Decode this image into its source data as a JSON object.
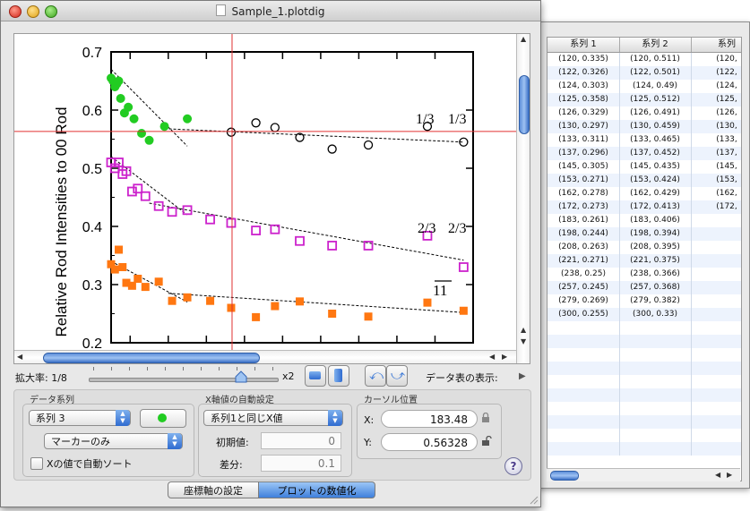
{
  "window": {
    "title": "Sample_1.plotdig"
  },
  "plot": {
    "ylabel": "Relative Rod Intensities to 00 Rod",
    "yticks": [
      "0.7",
      "0.6",
      "0.5",
      "0.4",
      "0.3",
      "0.2"
    ],
    "labels": {
      "a1": "1/3",
      "a2": "1/3",
      "b1": "2/3",
      "b2": "2/3",
      "c": "11"
    },
    "colors": {
      "crosshair": "#e03030",
      "green": "#22cc22",
      "magenta": "#cc22cc",
      "orange": "#ff7711"
    }
  },
  "chart_data": {
    "type": "scatter",
    "ylabel": "Relative Rod Intensities to 00 Rod",
    "ylim": [
      0.2,
      0.7
    ],
    "xlim": [
      120,
      310
    ],
    "grid": false,
    "crosshair": {
      "x": 183.48,
      "y": 0.56328
    },
    "series": [
      {
        "marker": "filled-circle",
        "color": "#22cc22",
        "x": [
          120,
          121,
          122,
          123,
          124,
          125,
          127,
          129,
          132,
          136,
          140,
          148,
          160
        ],
        "y": [
          0.655,
          0.65,
          0.64,
          0.645,
          0.65,
          0.62,
          0.595,
          0.605,
          0.585,
          0.56,
          0.548,
          0.572,
          0.585
        ]
      },
      {
        "marker": "open-circle",
        "color": "#000000",
        "x": [
          183,
          196,
          206,
          219,
          236,
          255,
          286,
          305
        ],
        "y": [
          0.562,
          0.578,
          0.57,
          0.553,
          0.533,
          0.54,
          0.572,
          0.545
        ]
      },
      {
        "marker": "open-square",
        "color": "#cc22cc",
        "x": [
          120,
          122,
          124,
          126,
          128,
          131,
          134,
          138,
          145,
          152,
          160,
          172,
          183,
          196,
          206,
          219,
          236,
          255,
          286,
          305
        ],
        "y": [
          0.51,
          0.5,
          0.51,
          0.49,
          0.495,
          0.46,
          0.465,
          0.452,
          0.435,
          0.425,
          0.428,
          0.412,
          0.406,
          0.393,
          0.395,
          0.375,
          0.367,
          0.367,
          0.384,
          0.33
        ]
      },
      {
        "marker": "filled-square",
        "color": "#ff7711",
        "x": [
          120,
          122,
          124,
          126,
          128,
          131,
          134,
          138,
          145,
          152,
          160,
          172,
          183,
          196,
          206,
          219,
          236,
          255,
          286,
          305
        ],
        "y": [
          0.335,
          0.326,
          0.36,
          0.33,
          0.303,
          0.298,
          0.31,
          0.296,
          0.305,
          0.272,
          0.278,
          0.272,
          0.26,
          0.244,
          0.263,
          0.271,
          0.25,
          0.245,
          0.269,
          0.255
        ]
      }
    ]
  },
  "zoom": {
    "label": "拡大率: 1/8",
    "max_label": "x2",
    "value": 0.8,
    "show_table_label": "データ表の表示:"
  },
  "series_group": {
    "title": "データ系列",
    "series_select": "系列 3",
    "color_swatch": "#22cc22",
    "style_select": "マーカーのみ",
    "autosort_label": "Xの値で自動ソート"
  },
  "xauto_group": {
    "title": "X軸値の自動設定",
    "mode_select": "系列1と同じX値",
    "initial_label": "初期値:",
    "initial_value": "0",
    "step_label": "差分:",
    "step_value": "0.1"
  },
  "cursor_group": {
    "title": "カーソル位置",
    "x_label": "X:",
    "x_value": "183.48",
    "y_label": "Y:",
    "y_value": "0.56328"
  },
  "tabs": {
    "axis_setup": "座標軸の設定",
    "digitize": "プロットの数値化"
  },
  "help": "?",
  "table": {
    "headers": [
      "系列 1",
      "系列 2",
      "系列"
    ],
    "rows": [
      [
        "(120, 0.335)",
        "(120, 0.511)",
        "(120,"
      ],
      [
        "(122, 0.326)",
        "(122, 0.501)",
        "(122,"
      ],
      [
        "(124, 0.303)",
        "(124, 0.49)",
        "(124,"
      ],
      [
        "(125, 0.358)",
        "(125, 0.512)",
        "(125,"
      ],
      [
        "(126, 0.329)",
        "(126, 0.491)",
        "(126,"
      ],
      [
        "(130, 0.297)",
        "(130, 0.459)",
        "(130,"
      ],
      [
        "(133, 0.311)",
        "(133, 0.465)",
        "(133,"
      ],
      [
        "(137, 0.296)",
        "(137, 0.452)",
        "(137,"
      ],
      [
        "(145, 0.305)",
        "(145, 0.435)",
        "(145,"
      ],
      [
        "(153, 0.271)",
        "(153, 0.424)",
        "(153,"
      ],
      [
        "(162, 0.278)",
        "(162, 0.429)",
        "(162,"
      ],
      [
        "(172, 0.273)",
        "(172, 0.413)",
        "(172,"
      ],
      [
        "(183, 0.261)",
        "(183, 0.406)",
        ""
      ],
      [
        "(198, 0.244)",
        "(198, 0.394)",
        ""
      ],
      [
        "(208, 0.263)",
        "(208, 0.395)",
        ""
      ],
      [
        "(221, 0.271)",
        "(221, 0.375)",
        ""
      ],
      [
        "(238, 0.25)",
        "(238, 0.366)",
        ""
      ],
      [
        "(257, 0.245)",
        "(257, 0.368)",
        ""
      ],
      [
        "(279, 0.269)",
        "(279, 0.382)",
        ""
      ],
      [
        "(300, 0.255)",
        "(300, 0.33)",
        ""
      ],
      [
        "",
        "",
        ""
      ],
      [
        "",
        "",
        ""
      ],
      [
        "",
        "",
        ""
      ],
      [
        "",
        "",
        ""
      ],
      [
        "",
        "",
        ""
      ],
      [
        "",
        "",
        ""
      ],
      [
        "",
        "",
        ""
      ],
      [
        "",
        "",
        ""
      ],
      [
        "",
        "",
        ""
      ],
      [
        "",
        "",
        ""
      ]
    ]
  }
}
